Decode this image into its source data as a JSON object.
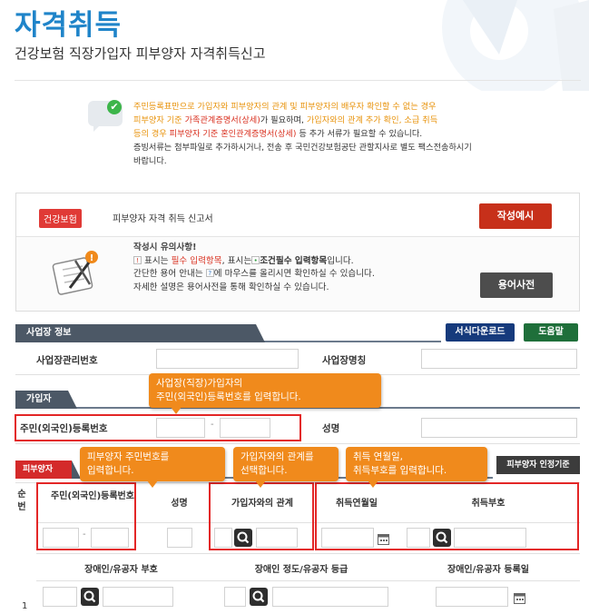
{
  "header": {
    "title": "자격취득",
    "subtitle": "건강보험 직장가입자 피부양자 자격취득신고"
  },
  "info": {
    "line1_a": "주민등록표만으로 가입자와 피부양자의 관계 및 피부양자의 배우자 확인할 수 없는 경우",
    "line2_a": "피부양자 기준 ",
    "line2_b": "가족관계증명서(상세)",
    "line2_c": "가 필요하며, ",
    "line2_d": "가입자와의 관계 추가 확인, 소급 취득",
    "line3_a": "등의 경우 ",
    "line3_b": "피부양자 기준 혼인관계증명서(상세)",
    "line3_c": " 등 추가 서류가 필요할 수 있습니다.",
    "line4": "증빙서류는 첨부파일로 추가하시거나, 전송 후 국민건강보험공단 관할지사로 별도 팩스전송하시기",
    "line5": "바랍니다."
  },
  "panel": {
    "badge": "건강보험",
    "form_title": "피부양자 자격 취득 신고서",
    "sample_button": "작성예시",
    "notes_title": "작성시 유의사항!",
    "notes_l1_pre": " 표시는 ",
    "notes_l1_red": "필수 입력항목",
    "notes_l1_mid": ",  표시는 ",
    "notes_l1_bold": "조건필수 입력항목",
    "notes_l1_post": "입니다.",
    "notes_l2_pre": "간단한 용어 안내는 ",
    "notes_l2_post": "에 마우스를 올리시면 확인하실 수 있습니다.",
    "notes_l3": "자세한 설명은 용어사전을 통해 확인하실 수 있습니다.",
    "mark_required": "!",
    "mark_conditional": "•",
    "mark_help": "?",
    "dict_button": "용어사전"
  },
  "workplace": {
    "section": "사업장 정보",
    "form_download": "서식다운로드",
    "help": "도움말",
    "mgmt_no_label": "사업장관리번호",
    "name_label": "사업장명칭"
  },
  "subscriber": {
    "section": "가입자",
    "rrn_label": "주민(외국인)등록번호",
    "dash": "-",
    "name_label": "성명"
  },
  "dependent": {
    "section": "피부양자",
    "criteria_button": "피부양자 인정기준",
    "col_no": "순번",
    "col_rrn": "주민(외국인)등록번호",
    "col_name": "성명",
    "col_relation": "가입자와의 관계",
    "col_date": "취득연월일",
    "col_code": "취득부호",
    "col_disabled_code": "장애인/유공자 부호",
    "col_disabled_grade": "장애인 정도/유공자 등급",
    "col_disabled_date": "장애인/유공자 등록일",
    "row_no": "1",
    "dash": "-"
  },
  "callouts": {
    "subscriber": "사업장(직장)가입자의\n주민(외국인)등록번호를 입력합니다.",
    "dep_rrn": "피부양자 주민번호를\n입력합니다.",
    "relation": "가입자와의 관계를\n선택합니다.",
    "date_code": "취득 연월일,\n취득부호를 입력합니다."
  },
  "icons": [
    "check-icon",
    "notes-icon",
    "search-icon",
    "calendar-icon"
  ],
  "colors": {
    "accent": "#1f84c9",
    "highlight": "#e8930c",
    "callout": "#f08a1c",
    "alert": "#e32626"
  }
}
